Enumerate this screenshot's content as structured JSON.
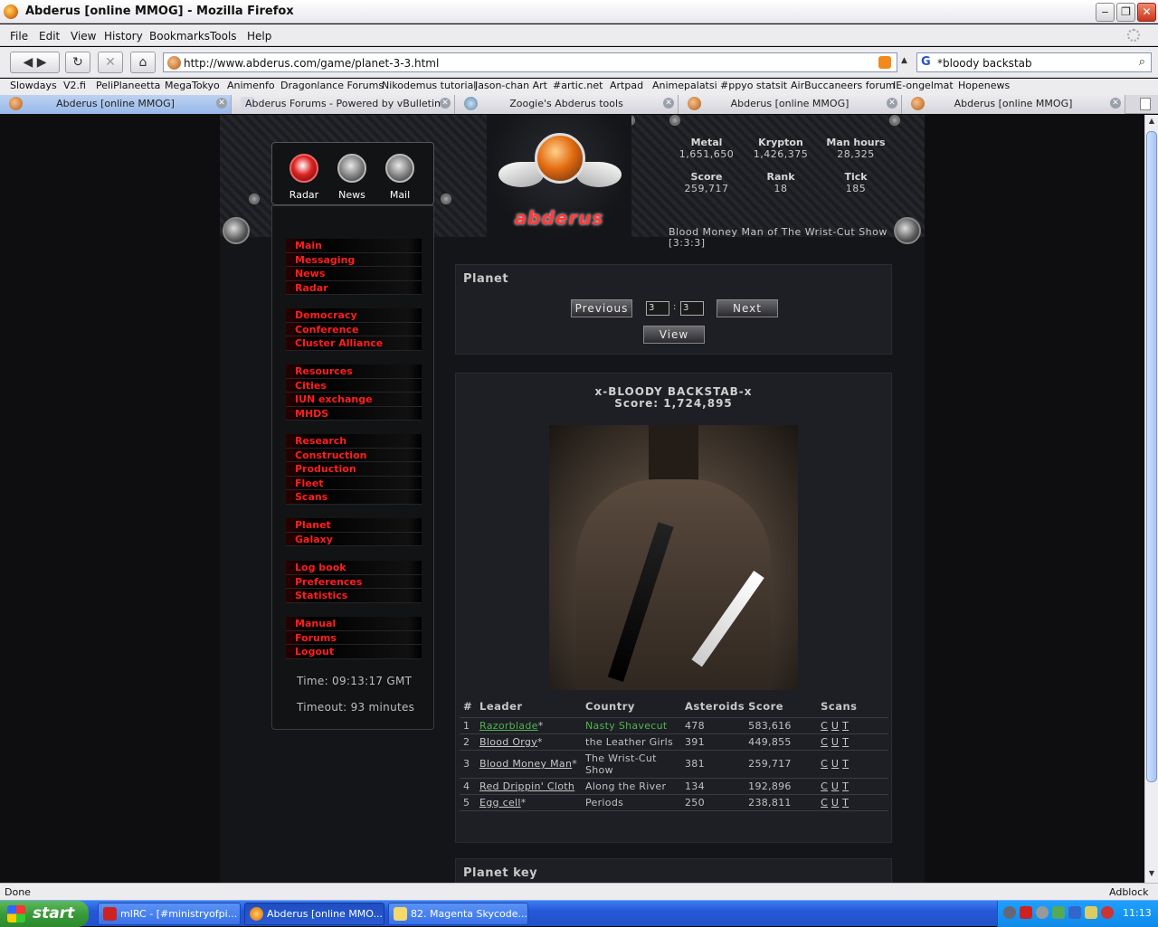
{
  "window": {
    "title": "Abderus [online MMOG] - Mozilla Firefox"
  },
  "menubar": [
    "File",
    "Edit",
    "View",
    "History",
    "Bookmarks",
    "Tools",
    "Help"
  ],
  "nav": {
    "url": "http://www.abderus.com/game/planet-3-3.html",
    "search": "*bloody backstab"
  },
  "bookmarks": [
    "Slowdays",
    "V2.fi",
    "PeliPlaneetta",
    "MegaTokyo",
    "Animenfo",
    "Dragonlance Forums",
    "Nikodemus tutorial",
    "Jason-chan Art",
    "#artic.net",
    "Artpad",
    "Animepalatsi",
    "#ppyo statsit",
    "AirBuccaneers forum",
    "IE-ongelmat",
    "Hopenews"
  ],
  "tabs": [
    "Abderus [online MMOG]",
    "Abderus Forums - Powered by vBulletin",
    "Zoogie's Abderus tools",
    "Abderus [online MMOG]",
    "Abderus [online MMOG]"
  ],
  "topnav": {
    "radar": "Radar",
    "news": "News",
    "mail": "Mail"
  },
  "logo": "abderus",
  "stats": {
    "metal": {
      "label": "Metal",
      "value": "1,651,650"
    },
    "krypton": {
      "label": "Krypton",
      "value": "1,426,375"
    },
    "manhours": {
      "label": "Man hours",
      "value": "28,325"
    },
    "score": {
      "label": "Score",
      "value": "259,717"
    },
    "rank": {
      "label": "Rank",
      "value": "18"
    },
    "tick": {
      "label": "Tick",
      "value": "185"
    }
  },
  "user": {
    "line1": "Blood Money Man of The Wrist-Cut Show",
    "line2": "[3:3:3]"
  },
  "sidebar": {
    "groups": [
      [
        "Main",
        "Messaging",
        "News",
        "Radar"
      ],
      [
        "Democracy",
        "Conference",
        "Cluster Alliance"
      ],
      [
        "Resources",
        "Cities",
        "IUN exchange",
        "MHDS"
      ],
      [
        "Research",
        "Construction",
        "Production",
        "Fleet",
        "Scans"
      ],
      [
        "Planet",
        "Galaxy"
      ],
      [
        "Log book",
        "Preferences",
        "Statistics"
      ],
      [
        "Manual",
        "Forums",
        "Logout"
      ]
    ],
    "time": "Time: 09:13:17 GMT",
    "timeout": "Timeout: 93 minutes"
  },
  "planetbox": {
    "title": "Planet",
    "prev": "Previous",
    "next": "Next",
    "view": "View",
    "x": "3",
    "y": "3"
  },
  "planet": {
    "name": "x-BLOODY BACKSTAB-x",
    "score": "Score: 1,724,895",
    "headers": [
      "#",
      "Leader",
      "Country",
      "Asteroids",
      "Score",
      "Scans"
    ],
    "rows": [
      {
        "n": "1",
        "leader": "Razorblade",
        "star": "*",
        "country": "Nasty Shavecut",
        "asteroids": "478",
        "score": "583,616",
        "scans": [
          "C",
          "U",
          "T"
        ]
      },
      {
        "n": "2",
        "leader": "Blood Orgy",
        "star": "*",
        "country": "the Leather Girls",
        "asteroids": "391",
        "score": "449,855",
        "scans": [
          "C",
          "U",
          "T"
        ]
      },
      {
        "n": "3",
        "leader": "Blood Money Man",
        "star": "*",
        "country": "The Wrist-Cut Show",
        "asteroids": "381",
        "score": "259,717",
        "scans": [
          "C",
          "U",
          "T"
        ]
      },
      {
        "n": "4",
        "leader": "Red Drippin' Cloth",
        "star": "",
        "country": "Along the River",
        "asteroids": "134",
        "score": "192,896",
        "scans": [
          "C",
          "U",
          "T"
        ]
      },
      {
        "n": "5",
        "leader": "Egg cell",
        "star": "*",
        "country": "Periods",
        "asteroids": "250",
        "score": "238,811",
        "scans": [
          "C",
          "U",
          "T"
        ]
      }
    ]
  },
  "planetkey": {
    "title": "Planet key"
  },
  "status": {
    "left": "Done",
    "right": "Adblock"
  },
  "taskbar": {
    "start": "start",
    "tasks": [
      "mIRC - [#ministryofpi...",
      "Abderus [online MMO...",
      "82. Magenta Skycode..."
    ],
    "clock": "11:13"
  },
  "colors": {
    "menu_red": "#ff1e1e",
    "green_link": "#52b152",
    "bg": "#0e0e10"
  }
}
